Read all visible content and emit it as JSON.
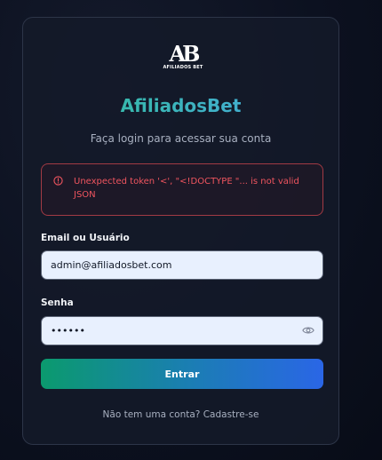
{
  "brand": {
    "logo_letters": "AB",
    "logo_subtext": "AFILIADOS BET",
    "title": "AfiliadosBet"
  },
  "login": {
    "subtitle": "Faça login para acessar sua conta",
    "error_message": "Unexpected token '<', \"<!DOCTYPE \"... is not valid JSON",
    "email_label": "Email ou Usuário",
    "email_value": "admin@afiliadosbet.com",
    "password_label": "Senha",
    "password_value": "••••••",
    "password_visibility_icon": "eye-icon",
    "submit_label": "Entrar",
    "signup_text": "Não tem uma conta? Cadastre-se"
  },
  "colors": {
    "accent_gradient_start": "#0b9a6e",
    "accent_gradient_end": "#2a66e6",
    "title_gradient_start": "#2fbf93",
    "title_gradient_end": "#4aa9e8",
    "error": "#f0555f",
    "error_border": "#a23a44",
    "background": "#0c1120"
  }
}
